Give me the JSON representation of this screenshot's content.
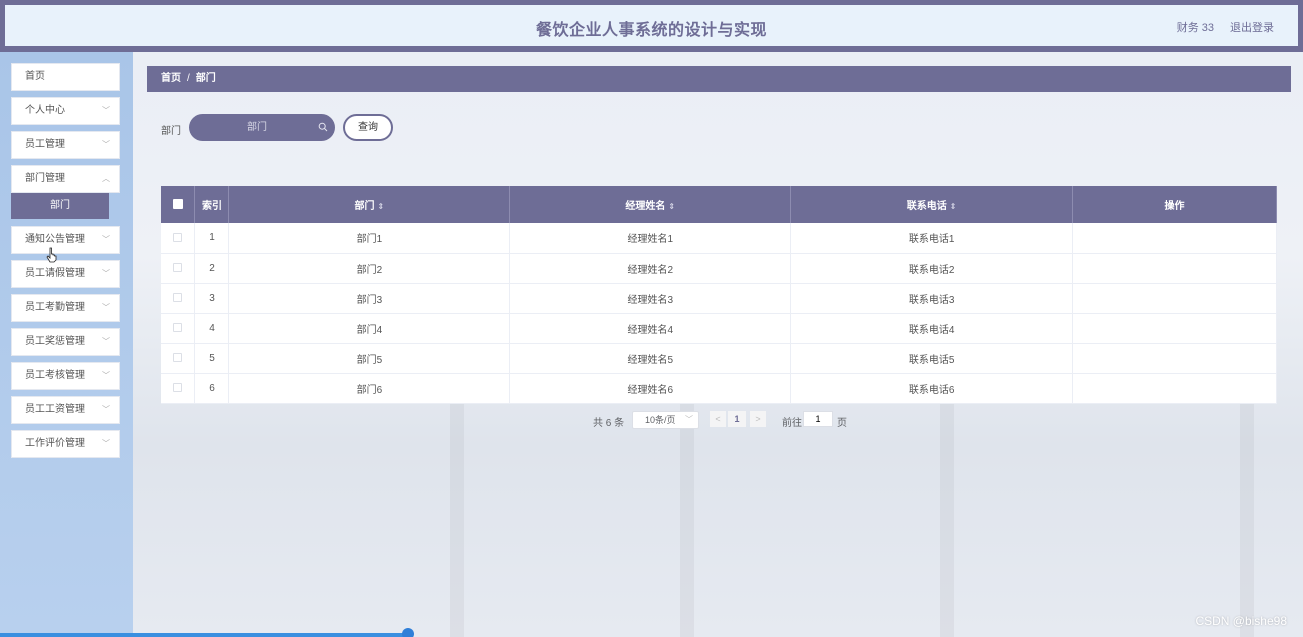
{
  "header": {
    "title": "餐饮企业人事系统的设计与实现",
    "user": "财务 33",
    "logout": "退出登录"
  },
  "sidebar": {
    "items": [
      {
        "label": "首页",
        "has_children": false
      },
      {
        "label": "个人中心",
        "has_children": true
      },
      {
        "label": "员工管理",
        "has_children": true
      },
      {
        "label": "部门管理",
        "has_children": true,
        "expanded": true,
        "children": [
          {
            "label": "部门",
            "active": true
          }
        ]
      },
      {
        "label": "通知公告管理",
        "has_children": true
      },
      {
        "label": "员工请假管理",
        "has_children": true
      },
      {
        "label": "员工考勤管理",
        "has_children": true
      },
      {
        "label": "员工奖惩管理",
        "has_children": true
      },
      {
        "label": "员工考核管理",
        "has_children": true
      },
      {
        "label": "员工工资管理",
        "has_children": true
      },
      {
        "label": "工作评价管理",
        "has_children": true
      }
    ]
  },
  "breadcrumb": {
    "home": "首页",
    "separator": "/",
    "current": "部门"
  },
  "search": {
    "label": "部门",
    "placeholder": "部门",
    "button": "查询"
  },
  "table": {
    "headers": {
      "index": "索引",
      "dept": "部门",
      "manager": "经理姓名",
      "phone": "联系电话",
      "actions": "操作"
    },
    "rows": [
      {
        "index": "1",
        "dept": "部门1",
        "manager": "经理姓名1",
        "phone": "联系电话1"
      },
      {
        "index": "2",
        "dept": "部门2",
        "manager": "经理姓名2",
        "phone": "联系电话2"
      },
      {
        "index": "3",
        "dept": "部门3",
        "manager": "经理姓名3",
        "phone": "联系电话3"
      },
      {
        "index": "4",
        "dept": "部门4",
        "manager": "经理姓名4",
        "phone": "联系电话4"
      },
      {
        "index": "5",
        "dept": "部门5",
        "manager": "经理姓名5",
        "phone": "联系电话5"
      },
      {
        "index": "6",
        "dept": "部门6",
        "manager": "经理姓名6",
        "phone": "联系电话6"
      }
    ]
  },
  "pagination": {
    "total": "共 6 条",
    "page_size": "10条/页",
    "current_page": "1",
    "goto_label": "前往",
    "goto_value": "1",
    "page_suffix": "页"
  },
  "watermark": "CSDN @bishe98",
  "colors": {
    "primary": "#6e6d96",
    "header_bg": "#e8f2fb",
    "sidebar_bg": "#b3cbeb"
  }
}
